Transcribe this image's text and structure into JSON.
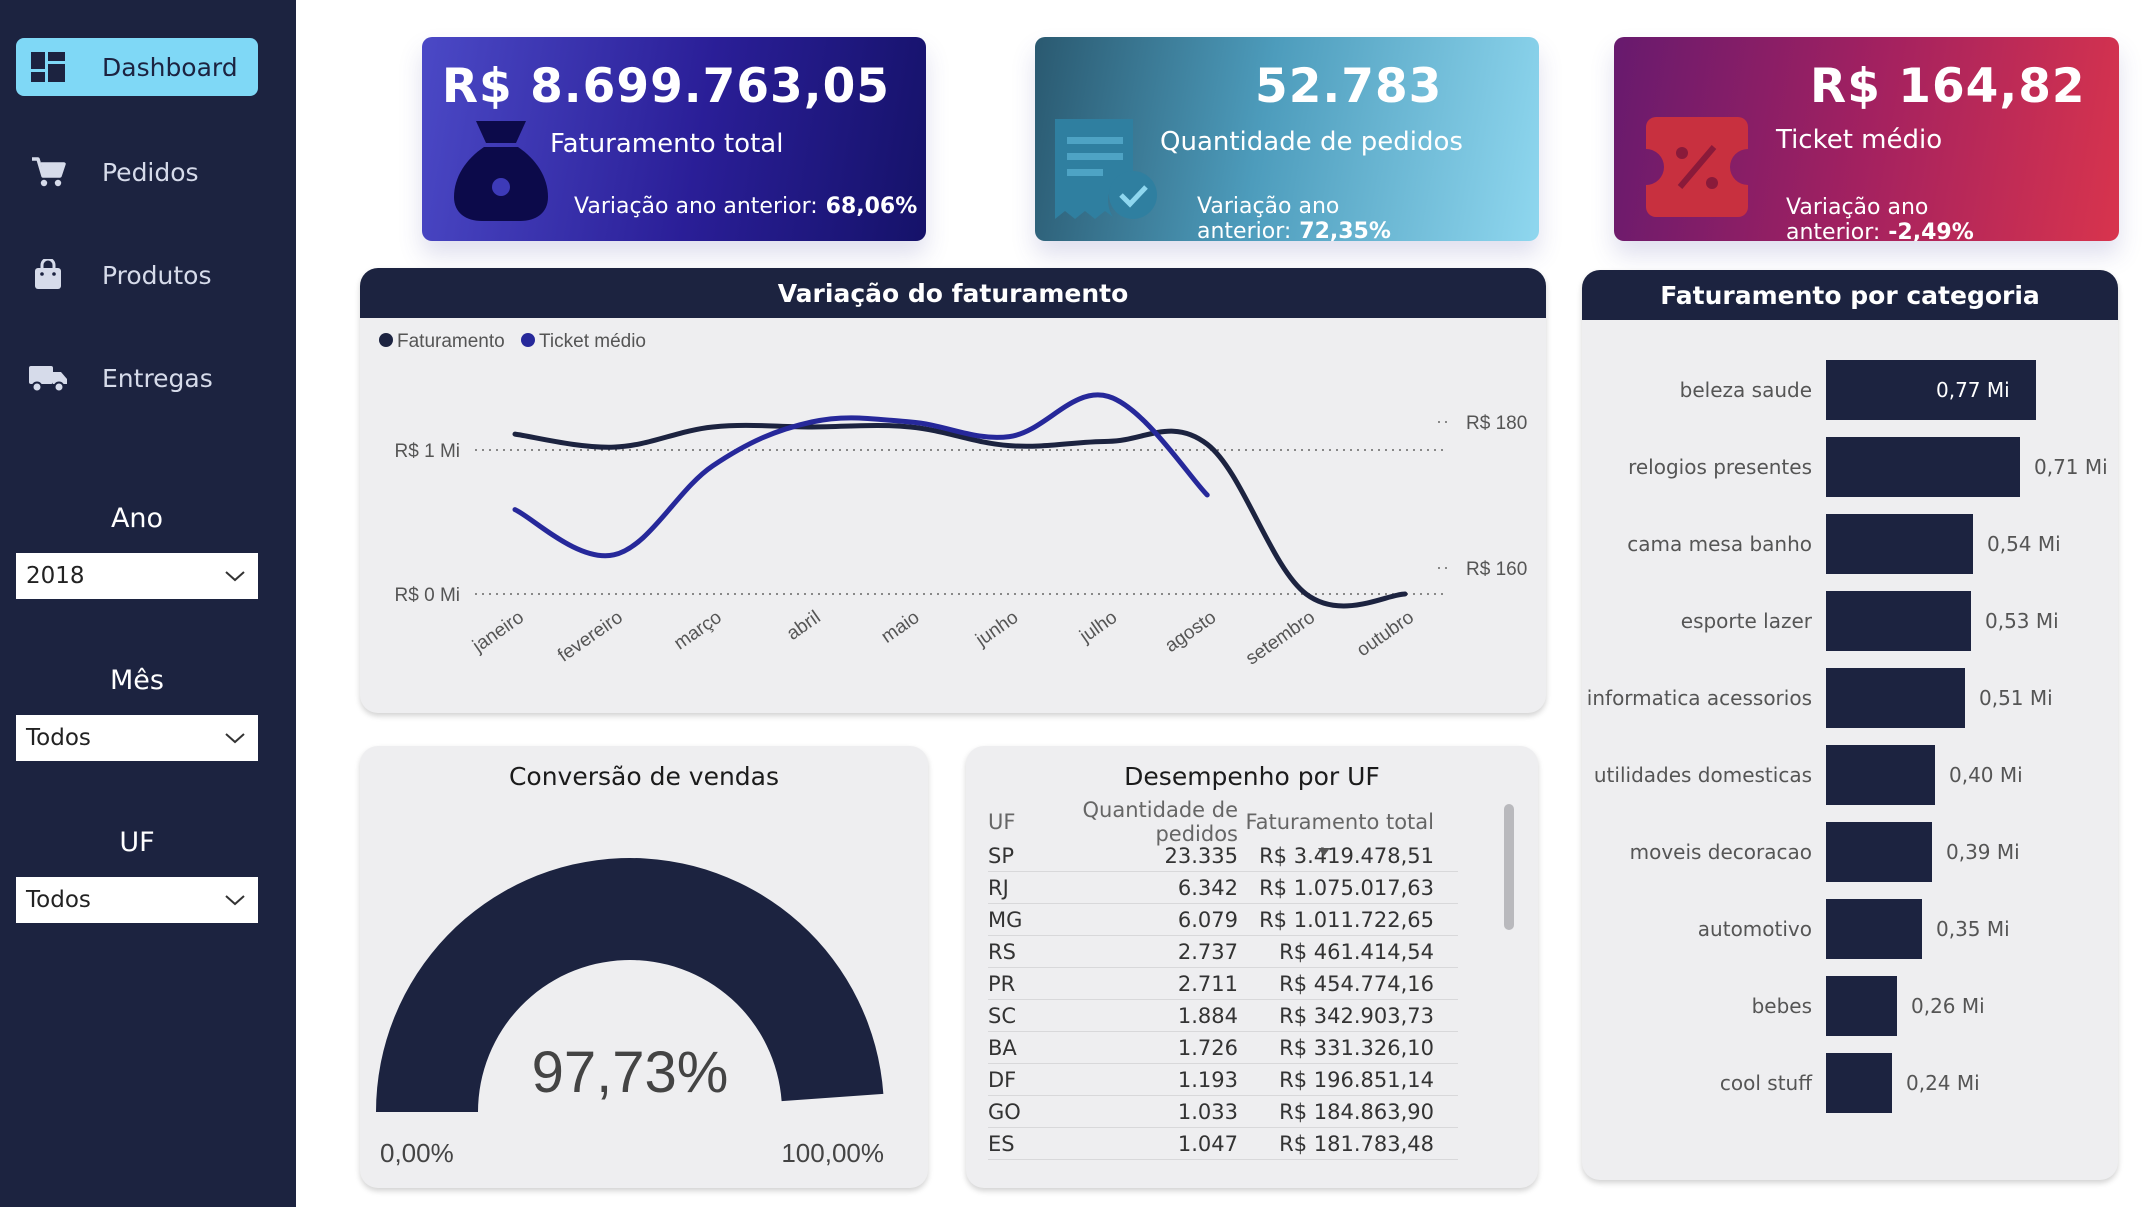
{
  "sidebar": {
    "nav": [
      {
        "label": "Dashboard",
        "icon": "dashboard-icon",
        "active": true
      },
      {
        "label": "Pedidos",
        "icon": "cart-icon",
        "active": false
      },
      {
        "label": "Produtos",
        "icon": "bag-icon",
        "active": false
      },
      {
        "label": "Entregas",
        "icon": "truck-icon",
        "active": false
      }
    ],
    "filters": [
      {
        "title": "Ano",
        "value": "2018"
      },
      {
        "title": "Mês",
        "value": "Todos"
      },
      {
        "title": "UF",
        "value": "Todos"
      }
    ]
  },
  "kpis": [
    {
      "value": "R$ 8.699.763,05",
      "label": "Faturamento total",
      "variation_label": "Variação ano anterior:",
      "variation_value": "68,06%",
      "icon": "money-bag-icon"
    },
    {
      "value": "52.783",
      "label": "Quantidade de pedidos",
      "variation_label": "Variação ano anterior:",
      "variation_value": "72,35%",
      "icon": "receipt-check-icon"
    },
    {
      "value": "R$ 164,82",
      "label": "Ticket médio",
      "variation_label": "Variação ano anterior:",
      "variation_value": "-2,49%",
      "icon": "discount-ticket-icon"
    }
  ],
  "line_chart": {
    "title": "Variação do faturamento",
    "legend": [
      {
        "name": "Faturamento",
        "color": "#1c2340"
      },
      {
        "name": "Ticket médio",
        "color": "#26289a"
      }
    ],
    "left_axis": [
      "R$ 1 Mi",
      "R$ 0 Mi"
    ],
    "right_axis": [
      "R$ 180",
      "R$ 160"
    ]
  },
  "gauge": {
    "title": "Conversão de vendas",
    "value_label": "97,73%",
    "value": 97.73,
    "min_label": "0,00%",
    "max_label": "100,00%"
  },
  "uf_table": {
    "title": "Desempenho por UF",
    "headers": [
      "UF",
      "Quantidade de pedidos",
      "Faturamento total"
    ],
    "rows": [
      [
        "SP",
        "23.335",
        "R$ 3.419.478,51"
      ],
      [
        "RJ",
        "6.342",
        "R$ 1.075.017,63"
      ],
      [
        "MG",
        "6.079",
        "R$ 1.011.722,65"
      ],
      [
        "RS",
        "2.737",
        "R$ 461.414,54"
      ],
      [
        "PR",
        "2.711",
        "R$ 454.774,16"
      ],
      [
        "SC",
        "1.884",
        "R$ 342.903,73"
      ],
      [
        "BA",
        "1.726",
        "R$ 331.326,10"
      ],
      [
        "DF",
        "1.193",
        "R$ 196.851,14"
      ],
      [
        "GO",
        "1.033",
        "R$ 184.863,90"
      ],
      [
        "ES",
        "1.047",
        "R$ 181.783,48"
      ]
    ]
  },
  "category_chart_title": "Faturamento por categoria",
  "chart_data": [
    {
      "type": "line",
      "title": "Variação do faturamento",
      "x": [
        "janeiro",
        "fevereiro",
        "março",
        "abril",
        "maio",
        "junho",
        "julho",
        "agosto",
        "setembro",
        "outubro"
      ],
      "series": [
        {
          "name": "Faturamento",
          "axis": "left",
          "unit": "Mi",
          "values": [
            1.11,
            1.02,
            1.16,
            1.16,
            1.16,
            1.03,
            1.06,
            1.04,
            0.0,
            0.0
          ]
        },
        {
          "name": "Ticket médio",
          "axis": "right",
          "unit": "R$",
          "values": [
            168.0,
            161.8,
            174.0,
            180.0,
            180.0,
            178.0,
            183.5,
            170.0,
            null,
            null
          ]
        }
      ],
      "ylim_left": [
        0,
        1
      ],
      "ylim_right": [
        160,
        180
      ],
      "grid": true,
      "legend_position": "top-left"
    },
    {
      "type": "bar",
      "title": "Faturamento por categoria",
      "orientation": "horizontal",
      "categories": [
        "beleza saude",
        "relogios presentes",
        "cama mesa banho",
        "esporte lazer",
        "informatica acessorios",
        "utilidades domesticas",
        "moveis decoracao",
        "automotivo",
        "bebes",
        "cool stuff"
      ],
      "values": [
        0.77,
        0.71,
        0.54,
        0.53,
        0.51,
        0.4,
        0.39,
        0.35,
        0.26,
        0.24
      ],
      "value_labels": [
        "0,77 Mi",
        "0,71 Mi",
        "0,54 Mi",
        "0,53 Mi",
        "0,51 Mi",
        "0,40 Mi",
        "0,39 Mi",
        "0,35 Mi",
        "0,26 Mi",
        "0,24 Mi"
      ]
    }
  ]
}
